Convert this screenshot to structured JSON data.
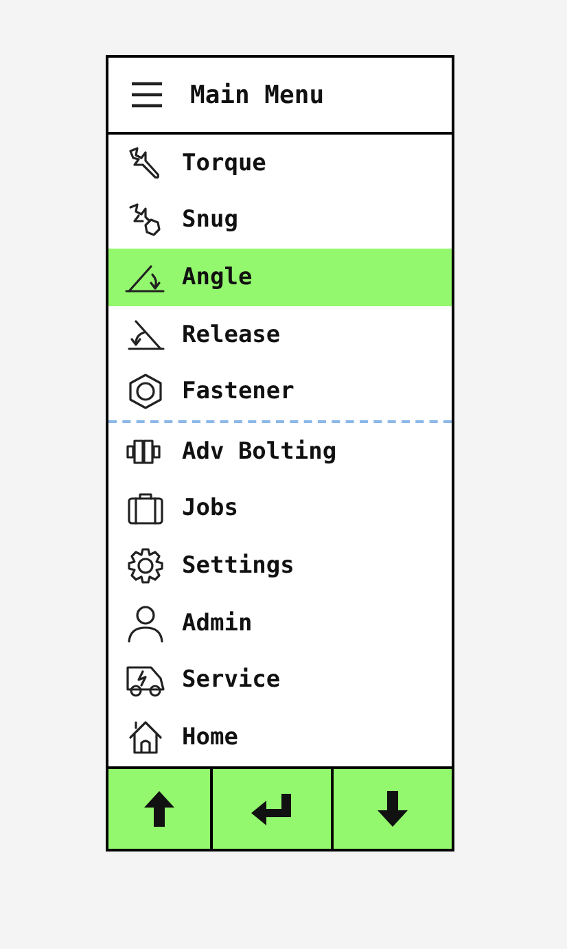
{
  "header": {
    "title": "Main Menu"
  },
  "sections": [
    [
      {
        "label": "Torque",
        "selected": false
      },
      {
        "label": "Snug",
        "selected": false
      },
      {
        "label": "Angle",
        "selected": true
      },
      {
        "label": "Release",
        "selected": false
      },
      {
        "label": "Fastener",
        "selected": false
      }
    ],
    [
      {
        "label": "Adv Bolting",
        "selected": false
      },
      {
        "label": "Jobs",
        "selected": false
      },
      {
        "label": "Settings",
        "selected": false
      },
      {
        "label": "Admin",
        "selected": false
      },
      {
        "label": "Service",
        "selected": false
      },
      {
        "label": "Home",
        "selected": false
      }
    ]
  ]
}
